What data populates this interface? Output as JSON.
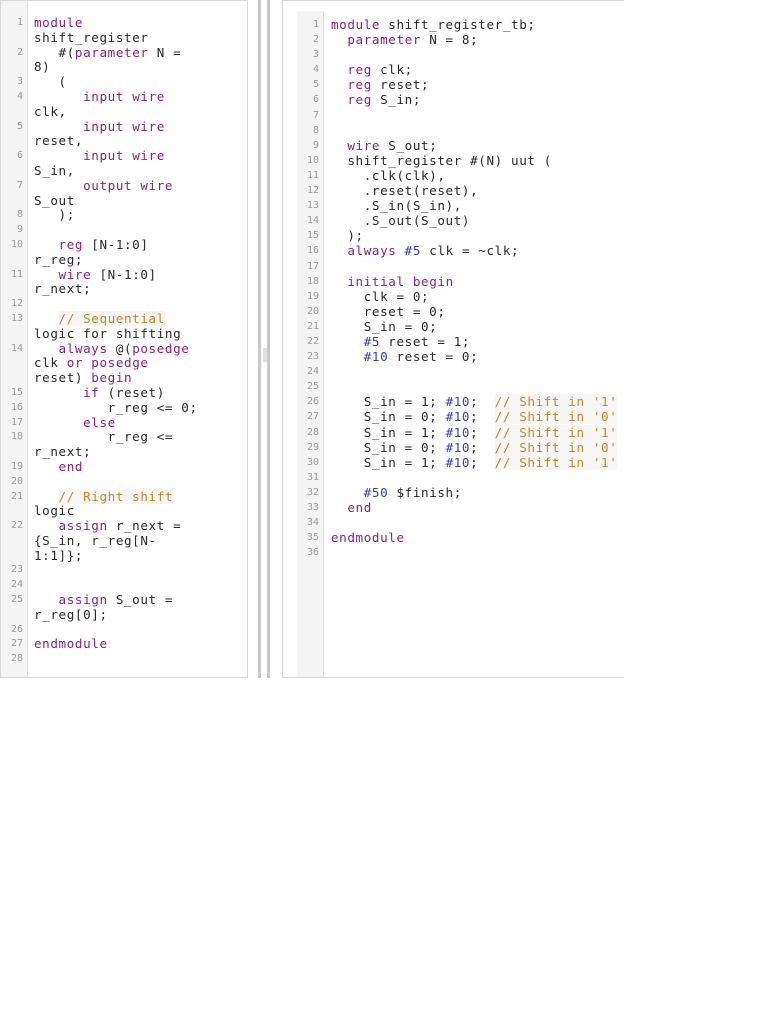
{
  "left_editor": {
    "rows": [
      {
        "n": "1",
        "t": "module"
      },
      {
        "n": "",
        "t": "shift_register"
      },
      {
        "n": "2",
        "t": "   #(parameter N ="
      },
      {
        "n": "",
        "t": "8)"
      },
      {
        "n": "3",
        "t": "   ("
      },
      {
        "n": "4",
        "t": "      input wire"
      },
      {
        "n": "",
        "t": "clk,"
      },
      {
        "n": "5",
        "t": "      input wire"
      },
      {
        "n": "",
        "t": "reset,"
      },
      {
        "n": "6",
        "t": "      input wire"
      },
      {
        "n": "",
        "t": "S_in,"
      },
      {
        "n": "7",
        "t": "      output wire"
      },
      {
        "n": "",
        "t": "S_out"
      },
      {
        "n": "8",
        "t": "   );"
      },
      {
        "n": "9",
        "t": ""
      },
      {
        "n": "10",
        "t": "   reg [N-1:0]"
      },
      {
        "n": "",
        "t": "r_reg;"
      },
      {
        "n": "11",
        "t": "   wire [N-1:0]"
      },
      {
        "n": "",
        "t": "r_next;"
      },
      {
        "n": "12",
        "t": ""
      },
      {
        "n": "13",
        "t": "   // Sequential"
      },
      {
        "n": "",
        "t": "logic for shifting"
      },
      {
        "n": "14",
        "t": "   always @(posedge"
      },
      {
        "n": "",
        "t": "clk or posedge"
      },
      {
        "n": "",
        "t": "reset) begin"
      },
      {
        "n": "15",
        "t": "      if (reset)"
      },
      {
        "n": "16",
        "t": "         r_reg <= 0;"
      },
      {
        "n": "17",
        "t": "      else"
      },
      {
        "n": "18",
        "t": "         r_reg <="
      },
      {
        "n": "",
        "t": "r_next;"
      },
      {
        "n": "19",
        "t": "   end"
      },
      {
        "n": "20",
        "t": ""
      },
      {
        "n": "21",
        "t": "   // Right shift"
      },
      {
        "n": "",
        "t": "logic"
      },
      {
        "n": "22",
        "t": "   assign r_next ="
      },
      {
        "n": "",
        "t": "{S_in, r_reg[N-"
      },
      {
        "n": "",
        "t": "1:1]};"
      },
      {
        "n": "23",
        "t": ""
      },
      {
        "n": "24",
        "t": ""
      },
      {
        "n": "25",
        "t": "   assign S_out ="
      },
      {
        "n": "",
        "t": "r_reg[0];"
      },
      {
        "n": "26",
        "t": ""
      },
      {
        "n": "27",
        "t": "endmodule"
      },
      {
        "n": "28",
        "t": ""
      }
    ]
  },
  "right_editor": {
    "rows": [
      {
        "n": "1",
        "t": "module shift_register_tb;"
      },
      {
        "n": "2",
        "t": "  parameter N = 8;"
      },
      {
        "n": "3",
        "t": ""
      },
      {
        "n": "4",
        "t": "  reg clk;"
      },
      {
        "n": "5",
        "t": "  reg reset;"
      },
      {
        "n": "6",
        "t": "  reg S_in;"
      },
      {
        "n": "7",
        "t": ""
      },
      {
        "n": "8",
        "t": ""
      },
      {
        "n": "9",
        "t": "  wire S_out;"
      },
      {
        "n": "10",
        "t": "  shift_register #(N) uut ("
      },
      {
        "n": "11",
        "t": "    .clk(clk),"
      },
      {
        "n": "12",
        "t": "    .reset(reset),"
      },
      {
        "n": "13",
        "t": "    .S_in(S_in),"
      },
      {
        "n": "14",
        "t": "    .S_out(S_out)"
      },
      {
        "n": "15",
        "t": "  );"
      },
      {
        "n": "16",
        "t": "  always #5 clk = ~clk;"
      },
      {
        "n": "17",
        "t": ""
      },
      {
        "n": "18",
        "t": "  initial begin"
      },
      {
        "n": "19",
        "t": "    clk = 0;"
      },
      {
        "n": "20",
        "t": "    reset = 0;"
      },
      {
        "n": "21",
        "t": "    S_in = 0;"
      },
      {
        "n": "22",
        "t": "    #5 reset = 1;"
      },
      {
        "n": "23",
        "t": "    #10 reset = 0;"
      },
      {
        "n": "24",
        "t": ""
      },
      {
        "n": "25",
        "t": ""
      },
      {
        "n": "26",
        "t": "    S_in = 1; #10;  // Shift in '1'"
      },
      {
        "n": "27",
        "t": "    S_in = 0; #10;  // Shift in '0'"
      },
      {
        "n": "28",
        "t": "    S_in = 1; #10;  // Shift in '1'"
      },
      {
        "n": "29",
        "t": "    S_in = 0; #10;  // Shift in '0'"
      },
      {
        "n": "30",
        "t": "    S_in = 1; #10;  // Shift in '1'"
      },
      {
        "n": "31",
        "t": ""
      },
      {
        "n": "32",
        "t": "    #50 $finish;"
      },
      {
        "n": "33",
        "t": "  end"
      },
      {
        "n": "34",
        "t": ""
      },
      {
        "n": "35",
        "t": "endmodule"
      },
      {
        "n": "36",
        "t": ""
      }
    ]
  }
}
